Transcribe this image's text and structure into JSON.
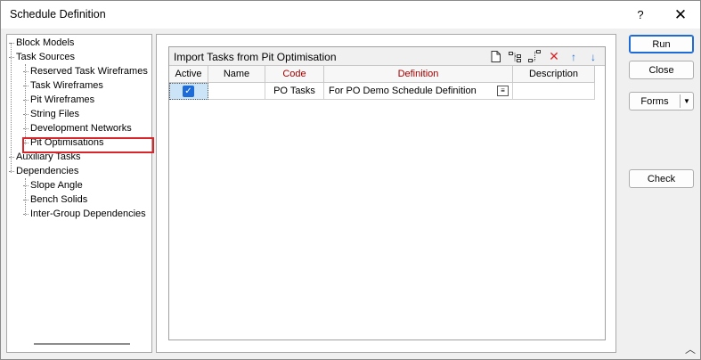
{
  "window": {
    "title": "Schedule Definition",
    "help_label": "?",
    "close_label": "✕"
  },
  "tree": {
    "items": [
      {
        "label": "Block Models"
      },
      {
        "label": "Task Sources"
      },
      {
        "label": "Reserved Task Wireframes"
      },
      {
        "label": "Task Wireframes"
      },
      {
        "label": "Pit Wireframes"
      },
      {
        "label": "String Files"
      },
      {
        "label": "Development Networks"
      },
      {
        "label": "Pit Optimisations"
      },
      {
        "label": "Auxiliary Tasks"
      },
      {
        "label": "Dependencies"
      },
      {
        "label": "Slope Angle"
      },
      {
        "label": "Bench Solids"
      },
      {
        "label": "Inter-Group Dependencies"
      }
    ],
    "selected": "Pit Optimisations"
  },
  "panel": {
    "title": "Import Tasks from Pit Optimisation",
    "toolbar": {
      "new_icon": "new-document-icon",
      "tree_icon": "tree-icon",
      "insert_icon": "insert-row-icon",
      "delete_icon": "delete-icon",
      "up_icon": "move-up-icon",
      "down_icon": "move-down-icon"
    },
    "columns": [
      "Active",
      "Name",
      "Code",
      "Definition",
      "Description"
    ],
    "rows": [
      {
        "active": true,
        "name": "",
        "code": "PO Tasks",
        "definition": "For PO Demo Schedule Definition",
        "description": ""
      }
    ]
  },
  "buttons": {
    "run": "Run",
    "close": "Close",
    "forms": "Forms",
    "check": "Check"
  },
  "colors": {
    "accent": "#1c6bd6",
    "highlight": "#d9262b",
    "header_red": "#a30000"
  }
}
